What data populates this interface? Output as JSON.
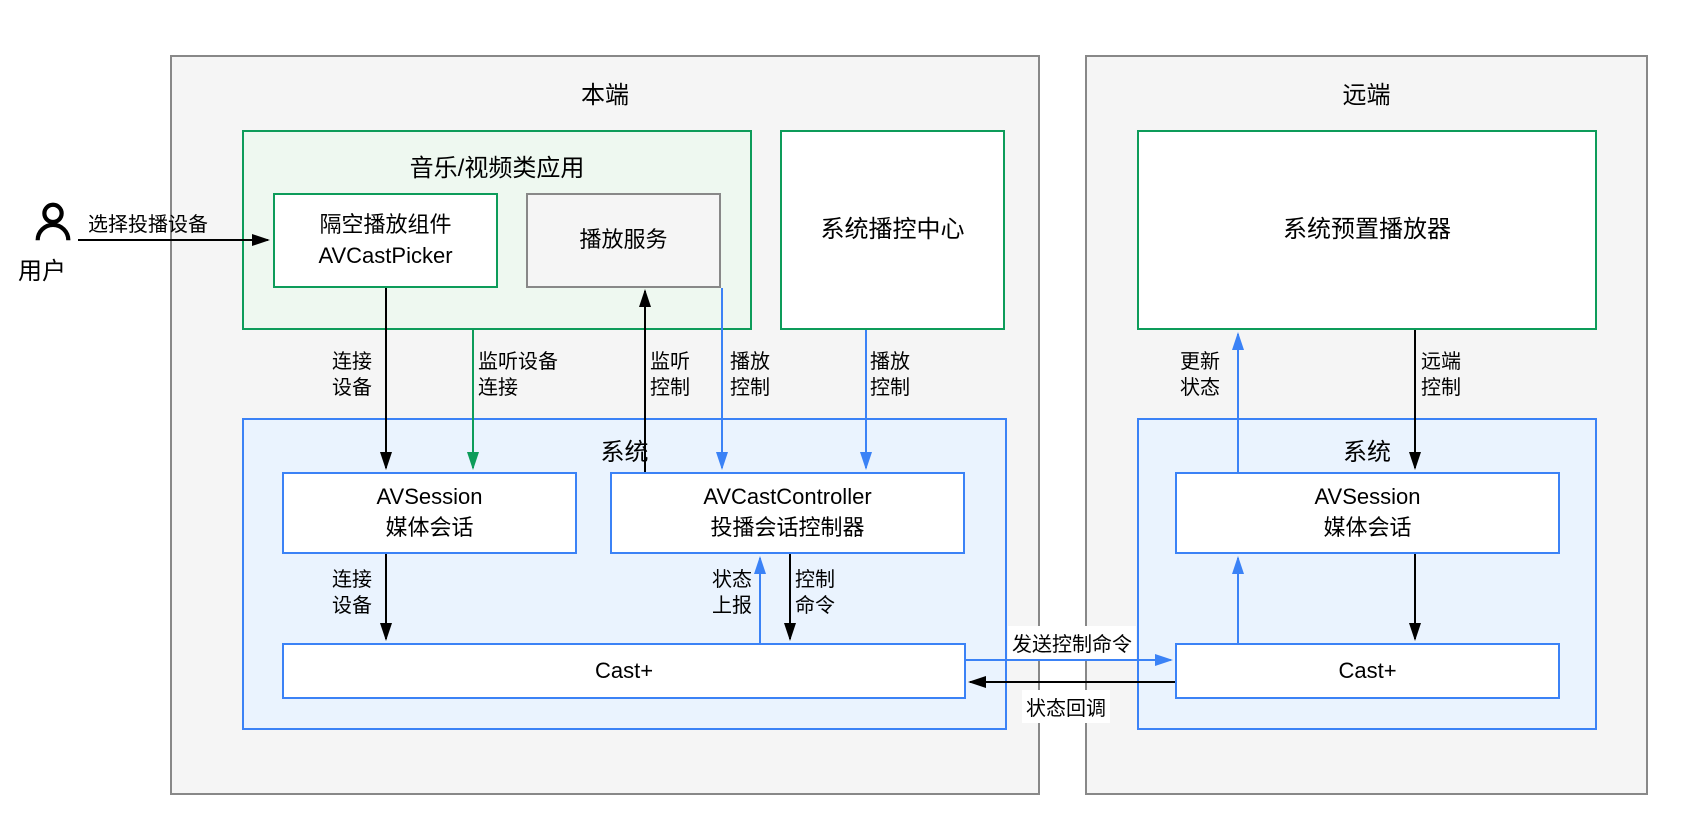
{
  "user": {
    "label": "用户"
  },
  "local": {
    "title": "本端",
    "app": {
      "title": "音乐/视频类应用",
      "picker": "隔空播放组件\nAVCastPicker",
      "service": "播放服务"
    },
    "controlCenter": "系统播控中心",
    "system": {
      "title": "系统",
      "avsession": "AVSession\n媒体会话",
      "controller": "AVCastController\n投播会话控制器",
      "cast": "Cast+"
    }
  },
  "remote": {
    "title": "远端",
    "player": "系统预置播放器",
    "system": {
      "title": "系统",
      "avsession": "AVSession\n媒体会话",
      "cast": "Cast+"
    }
  },
  "arrows": {
    "selectDevice": "选择投播设备",
    "connectDevice": "连接\n设备",
    "connectDevice2": "连接\n设备",
    "listenConnect": "监听设备\n连接",
    "listenControl": "监听\n控制",
    "playControl1": "播放\n控制",
    "playControl2": "播放\n控制",
    "statusReport": "状态\n上报",
    "controlCmd": "控制\n命令",
    "sendCmd": "发送控制命令",
    "statusCallback": "状态回调",
    "updateStatus": "更新\n状态",
    "remoteControl": "远端\n控制"
  },
  "colors": {
    "green": "#0d9c5a",
    "greenBg": "#eef8f0",
    "blue": "#3b82f6",
    "blueBg": "#eaf3fe",
    "gray": "#888888",
    "black": "#000000"
  }
}
